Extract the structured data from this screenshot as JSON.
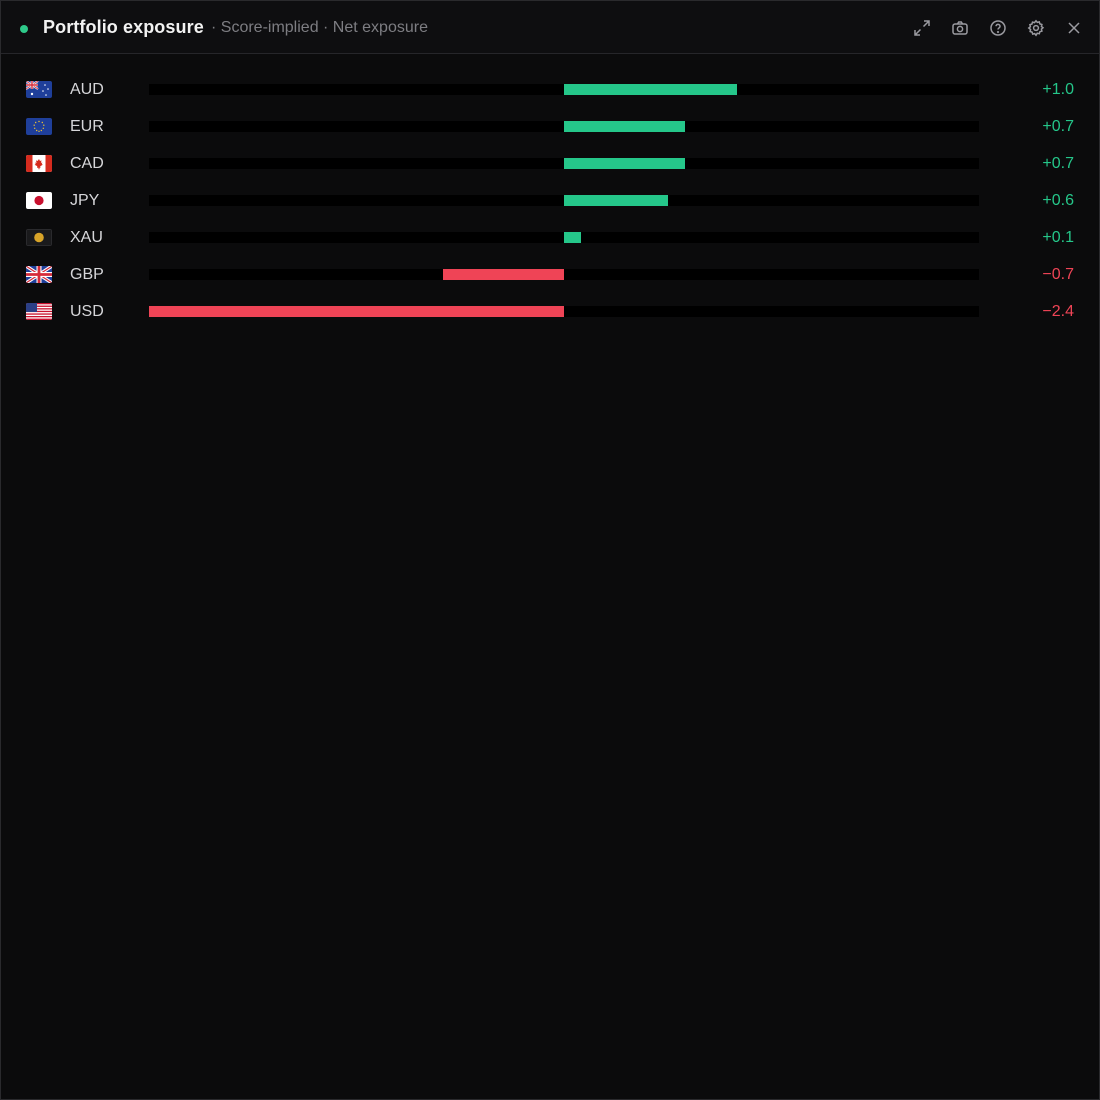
{
  "header": {
    "status_color": "#2ec98a",
    "title": "Portfolio exposure",
    "subtitle": "· Score-implied · Net exposure",
    "icons": [
      "expand-icon",
      "camera-icon",
      "help-icon",
      "settings-icon",
      "close-icon"
    ]
  },
  "colors": {
    "positive": "#25c78a",
    "negative": "#ef4456"
  },
  "scale": {
    "max_abs": 2.4
  },
  "rows": [
    {
      "code": "AUD",
      "value": 1.0,
      "label": "+1.0",
      "flag": "au-flag-icon"
    },
    {
      "code": "EUR",
      "value": 0.7,
      "label": "+0.7",
      "flag": "eu-flag-icon"
    },
    {
      "code": "CAD",
      "value": 0.7,
      "label": "+0.7",
      "flag": "ca-flag-icon"
    },
    {
      "code": "JPY",
      "value": 0.6,
      "label": "+0.6",
      "flag": "jp-flag-icon"
    },
    {
      "code": "XAU",
      "value": 0.1,
      "label": "+0.1",
      "flag": "gold-icon"
    },
    {
      "code": "GBP",
      "value": -0.7,
      "label": "−0.7",
      "flag": "gb-flag-icon"
    },
    {
      "code": "USD",
      "value": -2.4,
      "label": "−2.4",
      "flag": "us-flag-icon"
    }
  ]
}
